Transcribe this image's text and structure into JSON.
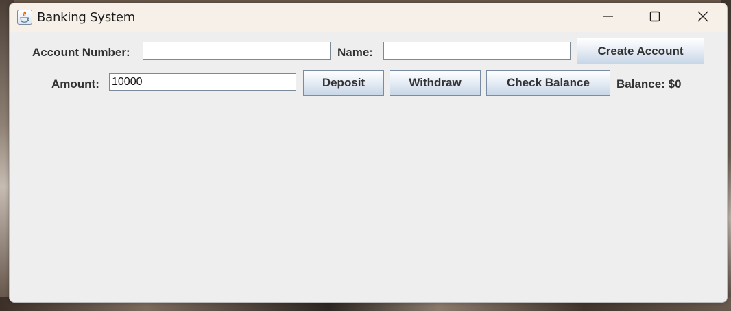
{
  "window": {
    "title": "Banking System",
    "app_icon": "java-cup-icon",
    "controls": {
      "minimize_icon": "minimize-icon",
      "maximize_icon": "maximize-icon",
      "close_icon": "close-icon"
    }
  },
  "form": {
    "account_number_label": "Account Number:",
    "account_number_value": "",
    "name_label": "Name:",
    "name_value": "",
    "create_account_label": "Create Account",
    "amount_label": "Amount:",
    "amount_value": "10000",
    "deposit_label": "Deposit",
    "withdraw_label": "Withdraw",
    "check_balance_label": "Check Balance",
    "balance_text": "Balance: $0"
  },
  "colors": {
    "window_bg": "#eeeeee",
    "titlebar_bg": "#f7f0e9",
    "label_text": "#333333",
    "button_gradient_top": "#ffffff",
    "button_gradient_bottom": "#c7d6e6",
    "button_border": "#7a8ca4"
  }
}
